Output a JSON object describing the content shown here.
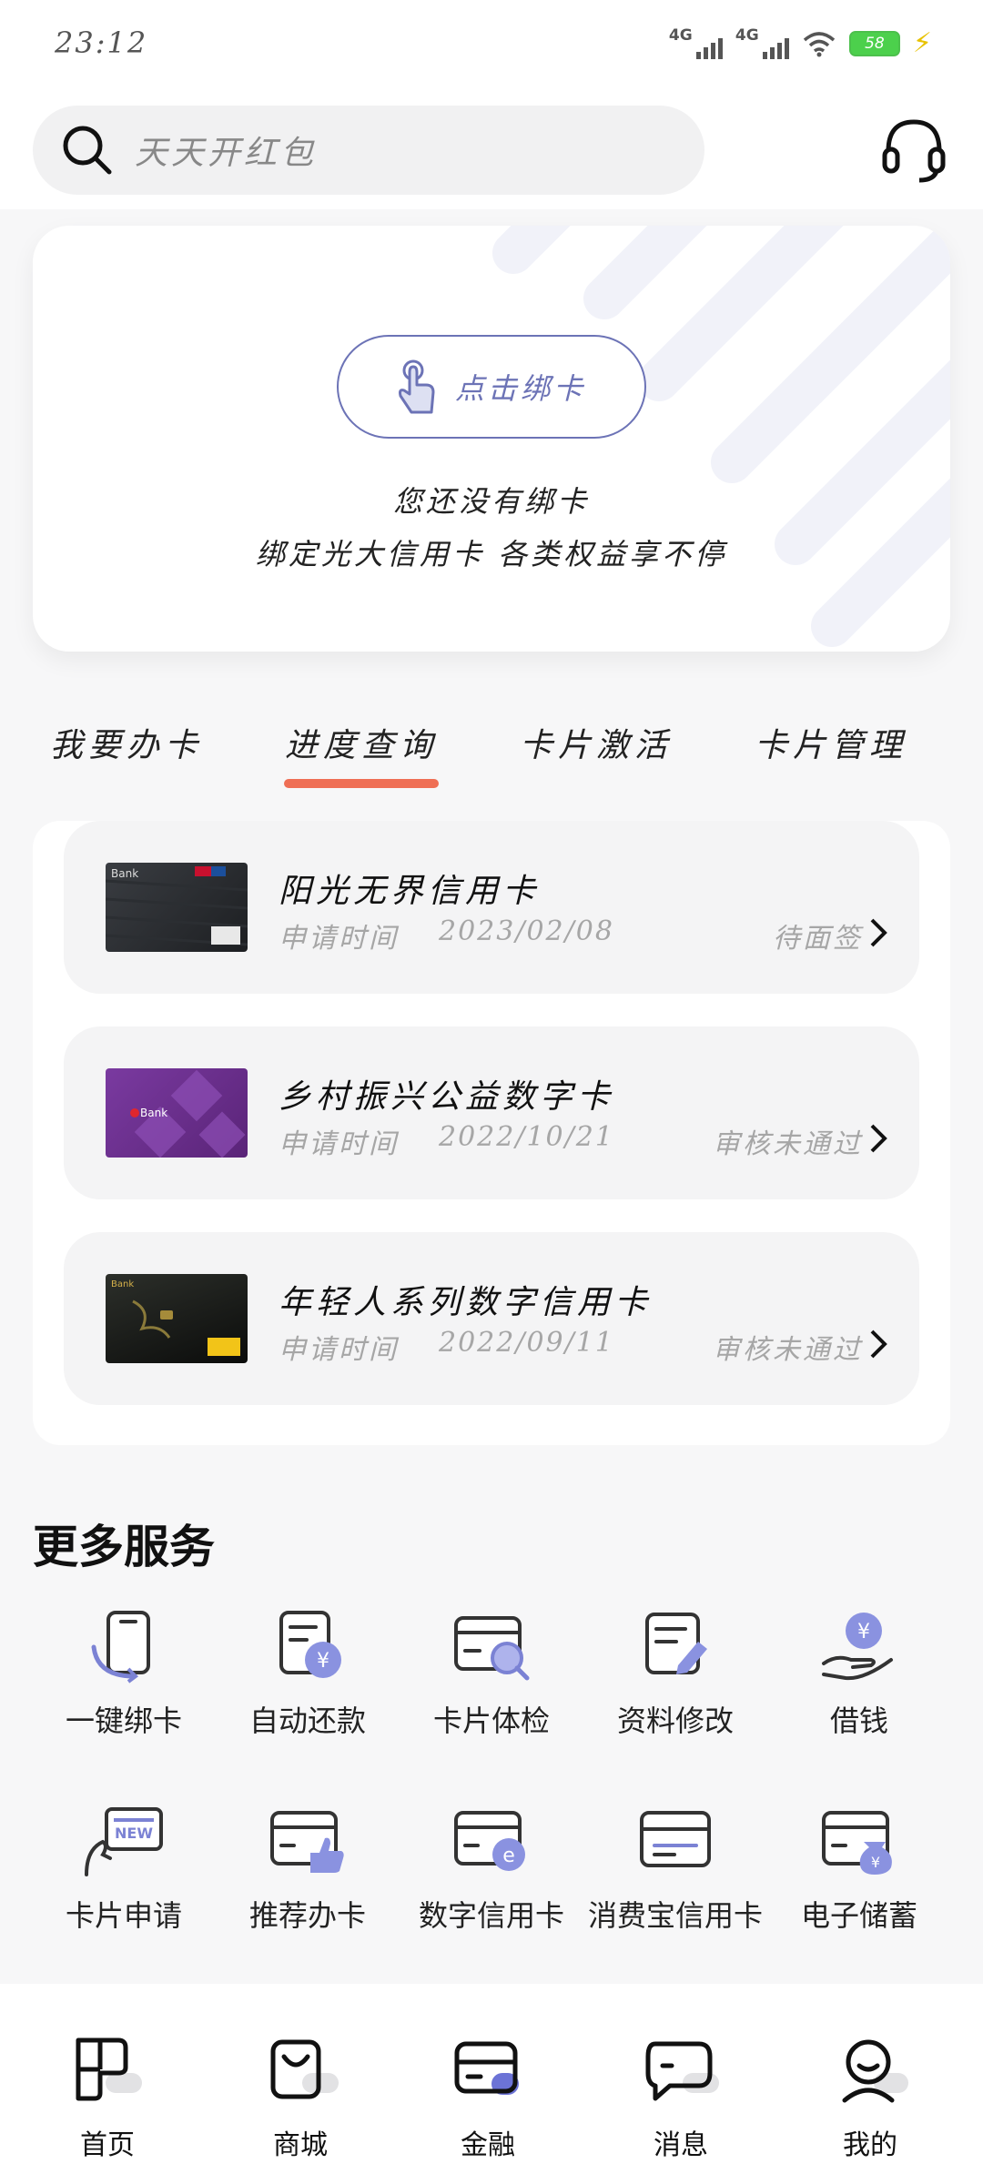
{
  "status_bar": {
    "time": "23:12",
    "signal1": "4G",
    "signal2": "4G",
    "battery": "58"
  },
  "search": {
    "placeholder": "天天开红包"
  },
  "bind_card": {
    "button_label": "点击绑卡",
    "line1": "您还没有绑卡",
    "line2": "绑定光大信用卡 各类权益享不停"
  },
  "tabs": [
    {
      "label": "我要办卡",
      "active": false
    },
    {
      "label": "进度查询",
      "active": true
    },
    {
      "label": "卡片激活",
      "active": false
    },
    {
      "label": "卡片管理",
      "active": false
    }
  ],
  "applications": [
    {
      "name": "阳光无界信用卡",
      "time_label": "申请时间",
      "date": "2023/02/08",
      "status": "待面签",
      "thumb_icon": "dark-platinum-card",
      "thumb_text": "Bank"
    },
    {
      "name": "乡村振兴公益数字卡",
      "time_label": "申请时间",
      "date": "2022/10/21",
      "status": "审核未通过",
      "thumb_icon": "purple-card",
      "thumb_text": "Bank"
    },
    {
      "name": "年轻人系列数字信用卡",
      "time_label": "申请时间",
      "date": "2022/09/11",
      "status": "审核未通过",
      "thumb_icon": "black-gold-card",
      "thumb_text": "Bank"
    }
  ],
  "more_services": {
    "title": "更多服务",
    "items": [
      {
        "label": "一键绑卡",
        "icon": "phone-card-icon"
      },
      {
        "label": "自动还款",
        "icon": "auto-repay-icon"
      },
      {
        "label": "卡片体检",
        "icon": "card-check-icon"
      },
      {
        "label": "资料修改",
        "icon": "edit-info-icon"
      },
      {
        "label": "借钱",
        "icon": "borrow-money-icon"
      },
      {
        "label": "卡片申请",
        "icon": "new-card-icon",
        "badge": "NEW"
      },
      {
        "label": "推荐办卡",
        "icon": "recommend-card-icon"
      },
      {
        "label": "数字信用卡",
        "icon": "digital-card-icon"
      },
      {
        "label": "消费宝信用卡",
        "icon": "consumer-card-icon"
      },
      {
        "label": "电子储蓄",
        "icon": "e-savings-icon"
      }
    ]
  },
  "bottom_nav": [
    {
      "label": "首页",
      "icon": "home-icon"
    },
    {
      "label": "商城",
      "icon": "mall-icon"
    },
    {
      "label": "金融",
      "icon": "finance-icon",
      "active": true
    },
    {
      "label": "消息",
      "icon": "message-icon"
    },
    {
      "label": "我的",
      "icon": "profile-icon"
    }
  ],
  "colors": {
    "accent": "#6c73b6",
    "tab_indicator": "#ef6f55",
    "battery": "#4cd04c"
  }
}
